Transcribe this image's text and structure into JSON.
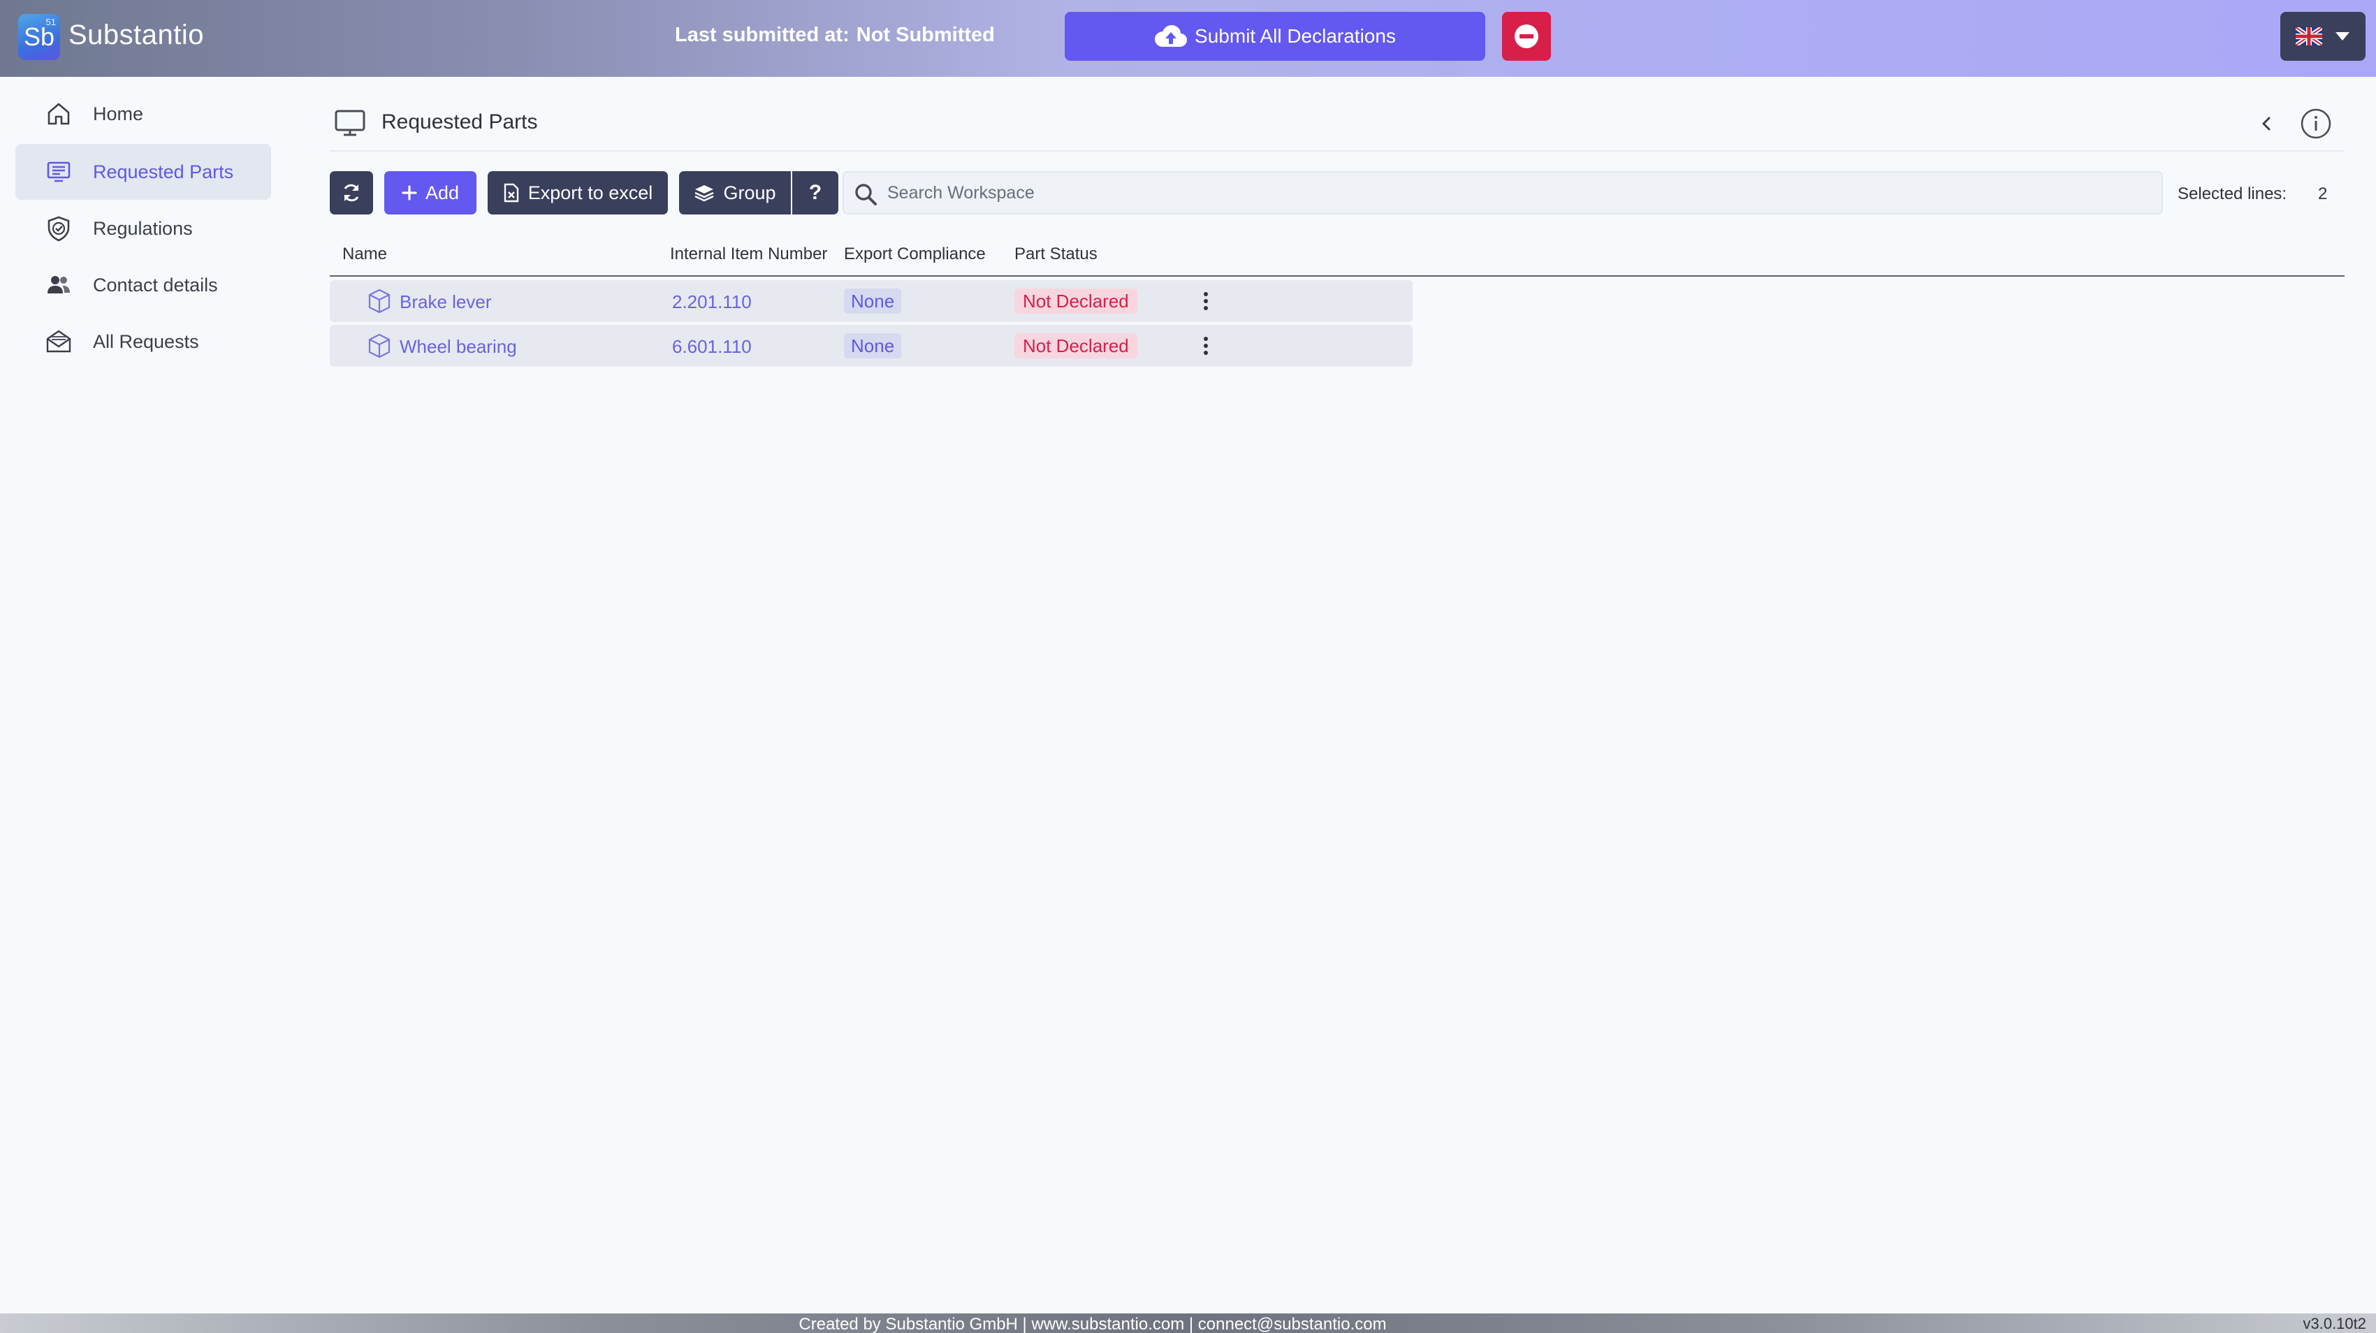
{
  "header": {
    "brand_logo": "Sb",
    "brand_logo_sup": "51",
    "brand_name": "Substantio",
    "last_submitted_label": "Last submitted at:",
    "last_submitted_value": "Not Submitted",
    "submit_all_label": "Submit All Declarations",
    "language": "en-GB"
  },
  "sidebar": {
    "items": [
      {
        "label": "Home",
        "icon": "home-icon",
        "active": false
      },
      {
        "label": "Requested Parts",
        "icon": "monitor-list-icon",
        "active": true
      },
      {
        "label": "Regulations",
        "icon": "shield-check-icon",
        "active": false
      },
      {
        "label": "Contact details",
        "icon": "users-icon",
        "active": false
      },
      {
        "label": "All Requests",
        "icon": "mail-open-icon",
        "active": false
      }
    ]
  },
  "main": {
    "title": "Requested Parts",
    "toolbar": {
      "add_label": "Add",
      "export_label": "Export to excel",
      "group_label": "Group",
      "help_label": "?"
    },
    "search": {
      "placeholder": "Search Workspace",
      "value": ""
    },
    "selected_lines_label": "Selected lines:",
    "selected_lines_count": "2",
    "table": {
      "headers": [
        "Name",
        "Internal Item Number",
        "Export Compliance",
        "Part Status"
      ],
      "rows": [
        {
          "name": "Brake lever",
          "item_number": "2.201.110",
          "export_compliance": "None",
          "status": "Not Declared"
        },
        {
          "name": "Wheel bearing",
          "item_number": "6.601.110",
          "export_compliance": "None",
          "status": "Not Declared"
        }
      ]
    }
  },
  "footer": {
    "text": "Created by Substantio GmbH | www.substantio.com | connect@substantio.com",
    "version": "v3.0.10t2"
  },
  "colors": {
    "accent": "#6358ef",
    "dark_button": "#3a3f5c",
    "danger": "#d81f4a",
    "link": "#6a62e3"
  }
}
